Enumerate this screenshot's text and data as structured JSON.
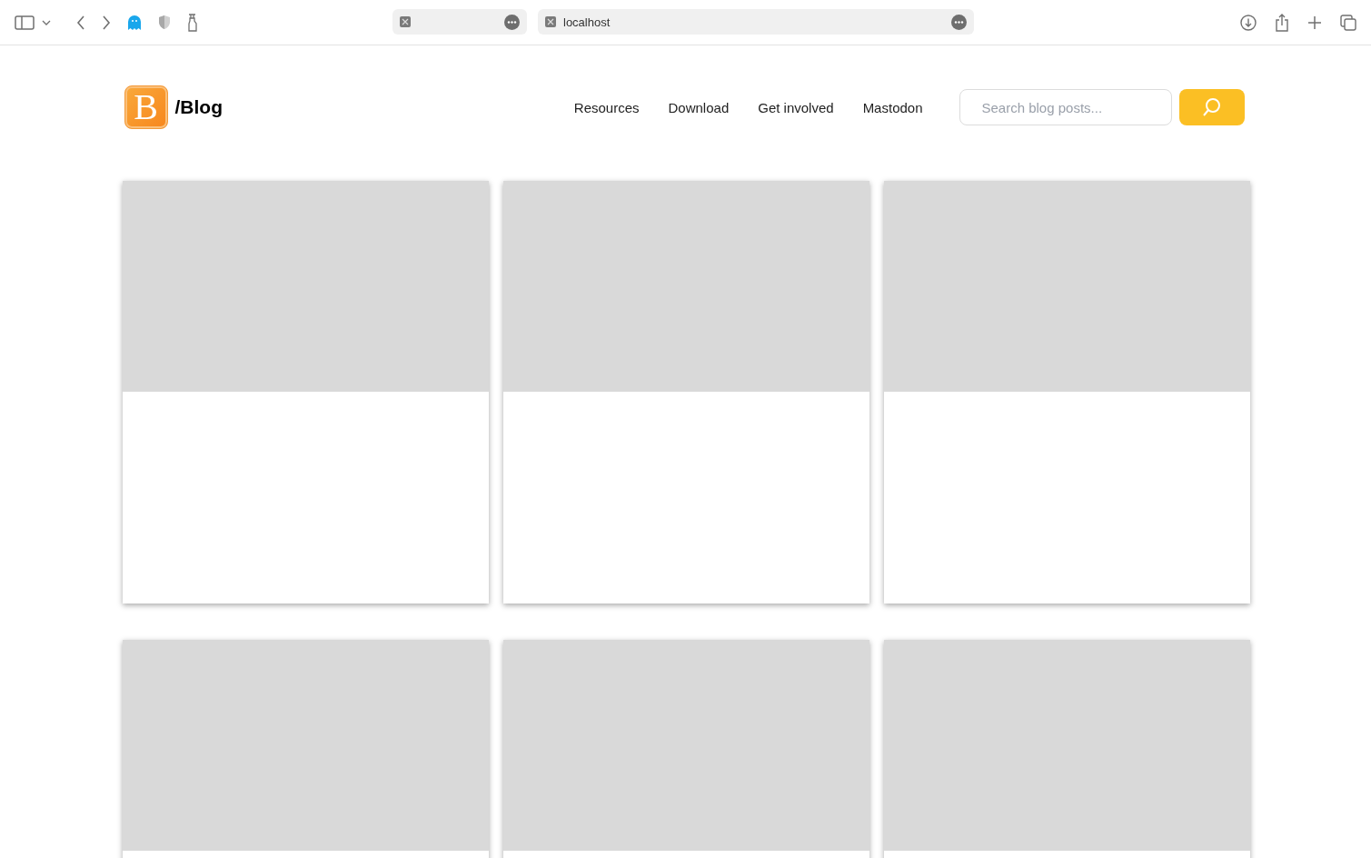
{
  "browser": {
    "tabs": [
      {
        "kind": "blank"
      },
      {
        "kind": "page",
        "title": "localhost"
      }
    ]
  },
  "header": {
    "logo_letter": "B",
    "site_title": "/Blog",
    "nav": [
      "Resources",
      "Download",
      "Get involved",
      "Mastodon"
    ],
    "search": {
      "placeholder": "Search blog posts..."
    }
  },
  "cards": [
    {
      "kind": "skeleton"
    },
    {
      "kind": "skeleton"
    },
    {
      "kind": "skeleton"
    },
    {
      "kind": "skeleton"
    },
    {
      "kind": "skeleton"
    },
    {
      "kind": "skeleton"
    }
  ]
}
